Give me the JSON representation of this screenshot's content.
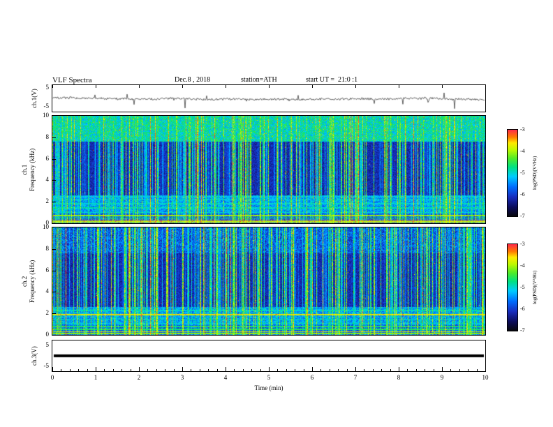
{
  "header": {
    "title": "VLF Spectra",
    "date": "Dec.8 , 2018",
    "station": "station=ATH",
    "start_ut": "start UT =  21:0 :1"
  },
  "xaxis": {
    "label": "Time (min)",
    "ticks": [
      "0",
      "1",
      "2",
      "3",
      "4",
      "5",
      "6",
      "7",
      "8",
      "9",
      "10"
    ],
    "range_min": [
      0,
      10
    ],
    "minor_per_division": 5
  },
  "panels": {
    "ch1_wave": {
      "ylabel": "ch.1(V)",
      "yticks": [
        "5",
        "-5"
      ],
      "yrange_V": [
        -5,
        5
      ]
    },
    "ch1_spec": {
      "channel": "ch.1",
      "ylabel": "Frequency (kHz)",
      "yticks": [
        "10",
        "8",
        "6",
        "4",
        "2",
        "0"
      ],
      "yrange_kHz": [
        0,
        10
      ]
    },
    "ch2_spec": {
      "channel": "ch.2",
      "ylabel": "Frequency (kHz)",
      "yticks": [
        "10",
        "8",
        "6",
        "4",
        "2",
        "0"
      ],
      "yrange_kHz": [
        0,
        10
      ]
    },
    "ch3_wave": {
      "ylabel": "ch.3(V)",
      "yticks": [
        "5",
        "-5"
      ],
      "yrange_V": [
        -5,
        5
      ]
    }
  },
  "colorbar": {
    "label": "log(PSD)(V²/Hz)",
    "ticks": [
      "-3",
      "-4",
      "-5",
      "-6",
      "-7"
    ],
    "range": [
      -7,
      -3
    ],
    "gradient_top_to_bottom": [
      "#ff2d46",
      "#ff6600",
      "#ffee00",
      "#aaff00",
      "#00dd66",
      "#00ccff",
      "#0064ff",
      "#0000aa",
      "#000010"
    ]
  },
  "chart_data": [
    {
      "id": "ch1_waveform",
      "type": "line",
      "title": "ch.1(V) amplitude",
      "xlabel": "Time (min)",
      "xlim": [
        0,
        10
      ],
      "ylabel": "ch.1(V)",
      "ylim": [
        -5,
        5
      ],
      "description": "Noisy voltage trace fluctuating near 0 V with frequent brief negative impulse spikes, many reaching about -5 V, occurring throughout the full 10-minute record."
    },
    {
      "id": "ch1_spectrogram",
      "type": "heatmap",
      "title": "ch.1 VLF spectrogram",
      "xlabel": "Time (min)",
      "xlim": [
        0,
        10
      ],
      "ylabel": "Frequency (kHz)",
      "ylim": [
        0,
        10
      ],
      "zlabel": "log(PSD)(V²/Hz)",
      "zlim": [
        -7,
        -3
      ],
      "description": "Dense broadband vertical impulse streaks (sferics) spanning 0-10 kHz; bright green/yellow noisy band above ~8 kHz; dark blue/black background between ~3 and 7.5 kHz; bright cyan-green banding below ~2.6 kHz with strong narrow yellow/red horizontal lines near 0.15-0.8 kHz.",
      "horizontal_lines_kHz": [
        0.15,
        0.32,
        0.52,
        0.75,
        1.05,
        1.45,
        1.85,
        2.2,
        2.5
      ]
    },
    {
      "id": "ch2_spectrogram",
      "type": "heatmap",
      "title": "ch.2 VLF spectrogram",
      "xlabel": "Time (min)",
      "xlim": [
        0,
        10
      ],
      "ylabel": "Frequency (kHz)",
      "ylim": [
        0,
        10
      ],
      "zlabel": "log(PSD)(V²/Hz)",
      "zlim": [
        -7,
        -3
      ],
      "description": "Similar broadband vertical impulse streaks over a dark 3-8 kHz background; upper band (8-10 kHz) darker than ch.1; strong yellow horizontal line near 1.9 kHz; bright cyan low-frequency banding below ~2.6 kHz with yellow/red lines near 0.15-0.8 kHz.",
      "horizontal_lines_kHz": [
        0.15,
        0.32,
        0.55,
        0.8,
        1.1,
        1.5,
        1.9,
        2.3
      ]
    },
    {
      "id": "ch3_waveform",
      "type": "line",
      "title": "ch.3(V) amplitude",
      "xlabel": "Time (min)",
      "xlim": [
        0,
        10
      ],
      "ylabel": "ch.3(V)",
      "ylim": [
        -5,
        5
      ],
      "description": "Flat constant thick black line near 0 V across the entire record (no signal variation on channel 3)."
    }
  ]
}
